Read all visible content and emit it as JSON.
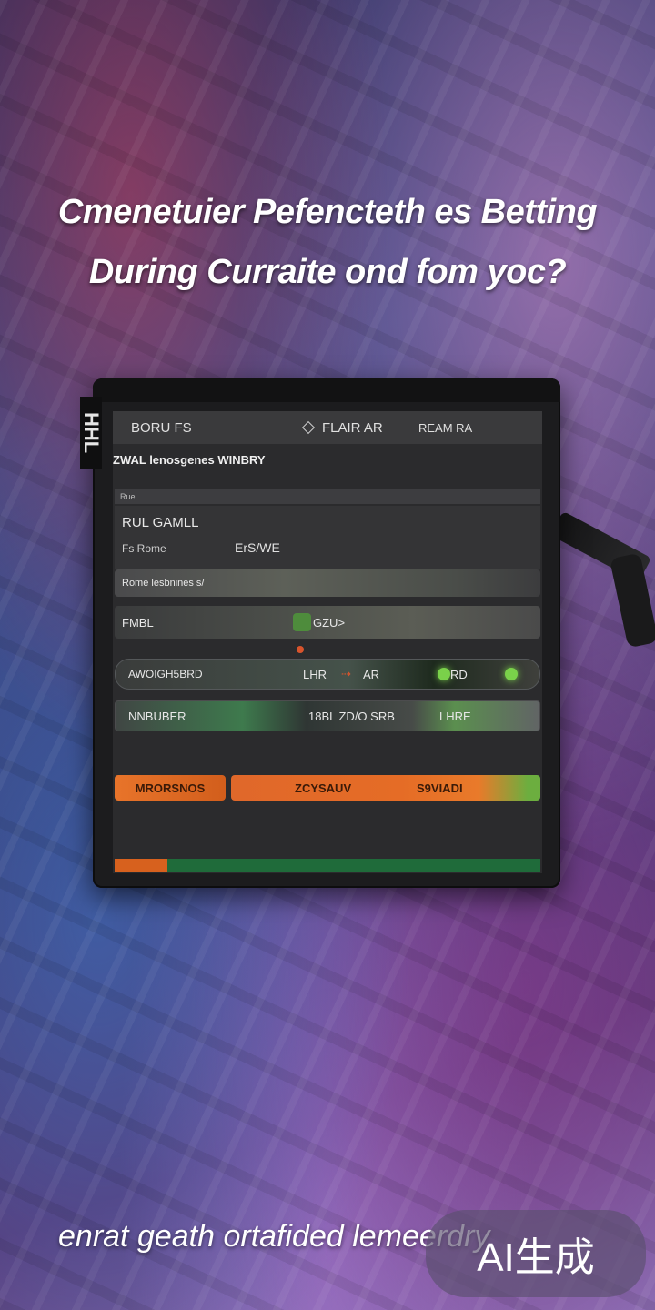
{
  "headline": {
    "line1": "Cmenetuier Pefencteth es Betting",
    "line2": "During Curraite ond fom yoc?"
  },
  "device": {
    "side_label": "HHL",
    "topbar": {
      "left": "BORU FS",
      "middle": "FLAIR AR",
      "right": "REAM RA"
    },
    "subtitle": "ZWAL lenosgenes WINBRY",
    "section_tag": "Rue",
    "game": {
      "title": "RUL GAMLL",
      "sub_left": "Fs Rome",
      "sub_right": "ErS/WE"
    },
    "rows": [
      {
        "label": "Rome lesbnines s/"
      },
      {
        "label": "FMBL",
        "value": "GZU>"
      },
      {
        "left": "AWOIGH5BRD",
        "middle": "LHR",
        "right": "AR",
        "value": "RD"
      },
      {
        "left": "NNBUBER",
        "middle": "18BL ZD/O SRB",
        "right": "LHRE"
      }
    ],
    "buttons": {
      "left": "MRORSNOS",
      "right_a": "ZCYSAUV",
      "right_b": "S9VIADI"
    }
  },
  "footer": "enrat geath ortafided lemeerdry",
  "watermark": "AI生成"
}
